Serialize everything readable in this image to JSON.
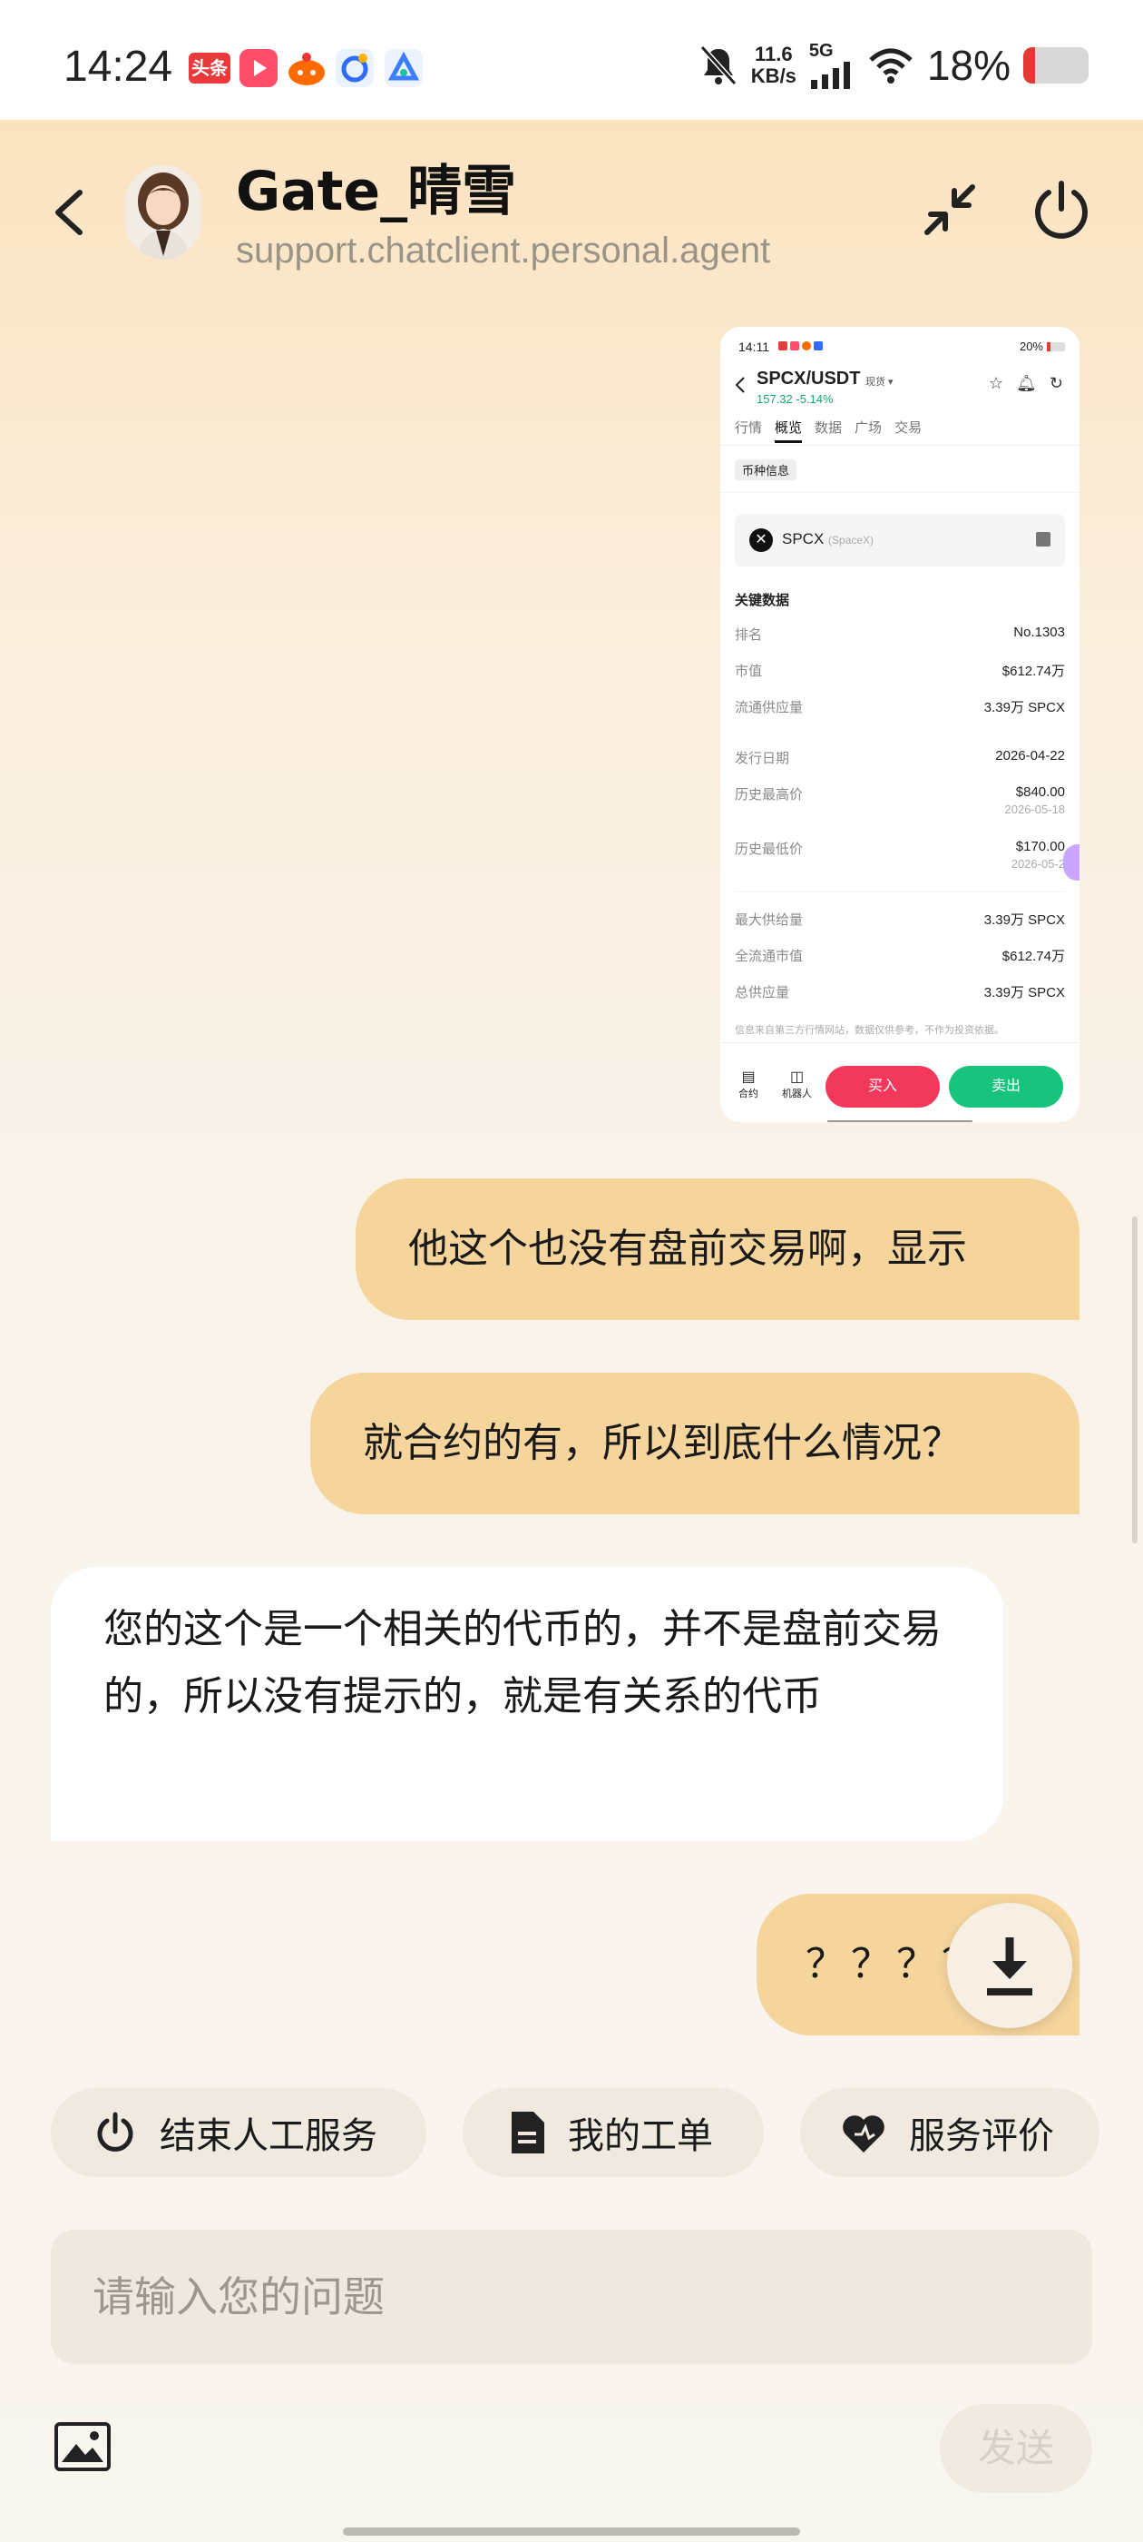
{
  "status_bar": {
    "time": "14:24",
    "apps": [
      {
        "icon": "toutiao-app-icon",
        "label": "头条",
        "color": "#e83a3a"
      },
      {
        "icon": "video-app-icon",
        "color": "#ff4d6a"
      },
      {
        "icon": "taobao-app-icon",
        "color": "#ff6a00"
      },
      {
        "icon": "baidu-app-icon",
        "color": "#2f6bff"
      },
      {
        "icon": "alibaba-cloud-app-icon",
        "color": "#3d7eff"
      }
    ],
    "net_speed_value": "11.6",
    "net_speed_unit": "KB/s",
    "network": "5G",
    "battery_text": "18%",
    "battery_level": 0.18
  },
  "header": {
    "title": "Gate_晴雪",
    "subtitle": "support.chatclient.personal.agent"
  },
  "screenshot": {
    "time": "14:11",
    "status_right": "20%",
    "pair": "SPCX/USDT",
    "market_type": "现货",
    "price": "157.32",
    "change": "-5.14%",
    "tabs": [
      "行情",
      "概览",
      "数据",
      "广场",
      "交易"
    ],
    "active_tab": "概览",
    "section_chip": "币种信息",
    "token_symbol": "SPCX",
    "token_name": "(SpaceX)",
    "key_data_title": "关键数据",
    "rows": [
      {
        "label": "排名",
        "value": "No.1303"
      },
      {
        "label": "市值",
        "value": "$612.74万"
      },
      {
        "label": "流通供应量",
        "value": "3.39万 SPCX"
      },
      {
        "label": "发行日期",
        "value": "2026-04-22"
      },
      {
        "label": "历史最高价",
        "value": "$840.00",
        "sub": "2026-05-18"
      },
      {
        "label": "历史最低价",
        "value": "$170.00",
        "sub": "2026-05-2"
      },
      {
        "label": "最大供给量",
        "value": "3.39万 SPCX"
      },
      {
        "label": "全流通市值",
        "value": "$612.74万"
      },
      {
        "label": "总供应量",
        "value": "3.39万 SPCX"
      }
    ],
    "disclaimer": "信息来自第三方行情网站，数据仅供参考，不作为投资依据。",
    "bottom_left_labels": [
      "合约",
      "机器人"
    ],
    "buy": "买入",
    "sell": "卖出"
  },
  "messages": {
    "out_1": "他这个也没有盘前交易啊，显示",
    "out_2": "就合约的有，所以到底什么情况？",
    "in_1": "您的这个是一个相关的代币的，并不是盘前交易的，所以没有提示的，就是有关系的代币",
    "out_3": "？？？？"
  },
  "actions": {
    "end_service": "结束人工服务",
    "my_tickets": "我的工单",
    "rate_service": "服务评价"
  },
  "composer": {
    "placeholder": "请输入您的问题",
    "send": "发送"
  },
  "colors": {
    "outgoing_bubble": "#f6d59d",
    "incoming_bubble": "#ffffff",
    "buy": "#f2395c",
    "sell": "#18c37e"
  }
}
